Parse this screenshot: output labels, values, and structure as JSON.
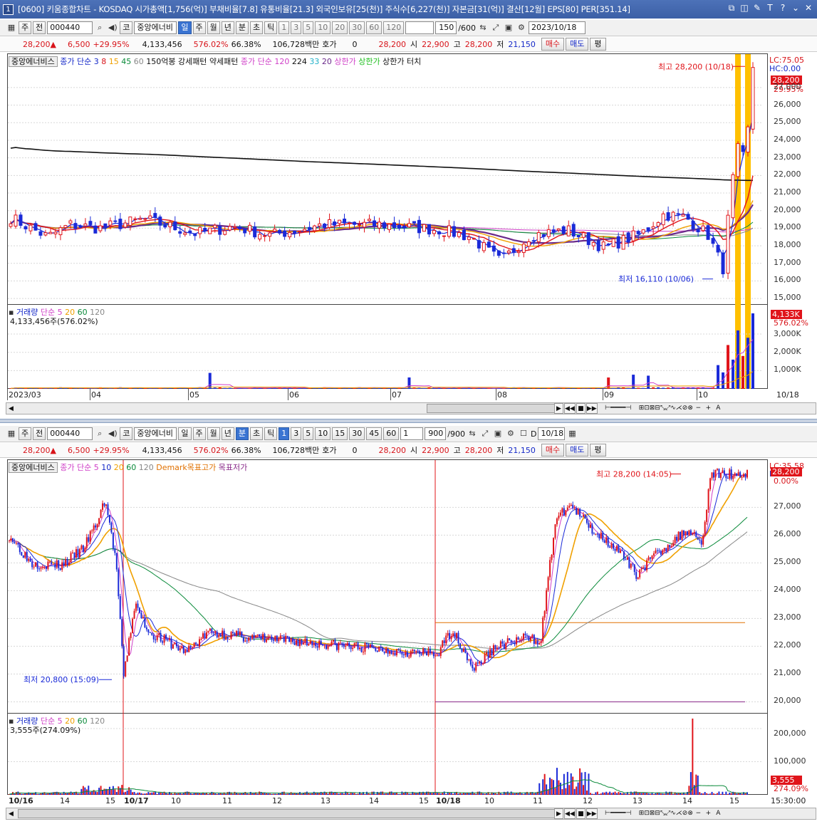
{
  "window": {
    "number": "1",
    "title": "[0600] 키움종합차트 - KOSDAQ 시가총액[1,756(억)] 부채비율[7.8] 유통비율[21.3] 외국인보유[25(천)] 주식수[6,227(천)] 자본금[31(억)] 결산[12월] EPS[80] PER[351.14]",
    "controls": [
      "⧉",
      "◫",
      "✎",
      "T",
      "?",
      "⌄",
      "✕"
    ]
  },
  "top": {
    "toolbar": {
      "mode": "주",
      "prev": "전",
      "code": "000440",
      "market": "코",
      "name": "중앙에너비",
      "periods": [
        "일",
        "주",
        "월",
        "년",
        "분",
        "초",
        "틱"
      ],
      "selected_period": "일",
      "intervals": [
        "1",
        "3",
        "5",
        "10",
        "20",
        "30",
        "60",
        "120"
      ],
      "count": "150",
      "total": "/600",
      "date": "2023/10/18"
    },
    "quote": {
      "price": "28,200",
      "arrow": "▲",
      "change": "6,500",
      "rate": "+29.95%",
      "volume": "4,133,456",
      "vol_rate": "576.02%",
      "ratio": "66.38%",
      "amount": "106,728백만",
      "hoga_label": "호가",
      "hoga": "0",
      "cur": "28,200",
      "open_label": "시",
      "open": "22,900",
      "high_label": "고",
      "high": "28,200",
      "low_label": "저",
      "low": "21,150",
      "buy": "매수",
      "sell": "매도",
      "eval": "평"
    },
    "legend": {
      "name": "중앙에너비스",
      "ma_label": "종가 단순 3",
      "ma": [
        "8",
        "15",
        "45",
        "60"
      ],
      "pattern1": "150억봉 강세패턴",
      "pattern2": "약세패턴",
      "ma2_label": "종가 단순 120",
      "ma2": [
        "224",
        "33",
        "20"
      ],
      "limit_up": "상한가",
      "limit_up2": "상한가",
      "limit_touch": "상한가 터치"
    },
    "lc": "LC:75.05",
    "hc": "HC:0.00",
    "price_box": "28,200",
    "price_pct": "29.95%",
    "y_ticks": [
      "27,000",
      "26,000",
      "25,000",
      "24,000",
      "23,000",
      "22,000",
      "21,000",
      "20,000",
      "19,000",
      "18,000",
      "17,000",
      "16,000",
      "15,000"
    ],
    "high_note": "최고 28,200 (10/18)",
    "low_note": "최저 16,110 (10/06)",
    "vol_legend": {
      "label": "거래량",
      "type": "단순",
      "ma": [
        "5",
        "20",
        "60",
        "120"
      ]
    },
    "vol_value": "4,133,456주(576.02%)",
    "vol_box": "4,133K",
    "vol_pct": "576.02%",
    "vol_ticks": [
      "3,000K",
      "2,000K",
      "1,000K"
    ],
    "x_labels": [
      "2023/03",
      "04",
      "05",
      "06",
      "07",
      "08",
      "09",
      "10",
      "10/18"
    ]
  },
  "bottom": {
    "toolbar": {
      "mode": "주",
      "prev": "전",
      "code": "000440",
      "market": "코",
      "name": "중앙에너비",
      "periods": [
        "일",
        "주",
        "월",
        "년",
        "분",
        "초",
        "틱"
      ],
      "selected_period": "분",
      "intervals": [
        "1",
        "3",
        "5",
        "10",
        "15",
        "30",
        "45",
        "60"
      ],
      "sel_interval": "1",
      "count": "900",
      "total": "/900",
      "date": "10/18",
      "d_label": "D"
    },
    "quote": {
      "price": "28,200",
      "arrow": "▲",
      "change": "6,500",
      "rate": "+29.95%",
      "volume": "4,133,456",
      "vol_rate": "576.02%",
      "ratio": "66.38%",
      "amount": "106,728백만",
      "hoga_label": "호가",
      "hoga": "0",
      "cur": "28,200",
      "open_label": "시",
      "open": "22,900",
      "high_label": "고",
      "high": "28,200",
      "low_label": "저",
      "low": "21,150",
      "buy": "매수",
      "sell": "매도",
      "eval": "평"
    },
    "legend": {
      "name": "중앙에너비스",
      "ma_label": "종가 단순 5",
      "ma": [
        "10",
        "20",
        "60",
        "120"
      ],
      "demark_high": "Demark목표고가",
      "demark_low": "목표저가"
    },
    "lc": "LC:35.58",
    "hc": "HC:0.00",
    "price_box": "28,200",
    "price_pct": "0.00%",
    "y_ticks": [
      "27,000",
      "26,000",
      "25,000",
      "24,000",
      "23,000",
      "22,000",
      "21,000",
      "20,000"
    ],
    "high_note": "최고 28,200 (14:05)",
    "low_note": "최저 20,800 (15:09)",
    "vol_legend": {
      "label": "거래량",
      "type": "단순",
      "ma": [
        "5",
        "20",
        "60",
        "120"
      ]
    },
    "vol_value": "3,555주(274.09%)",
    "vol_box": "3,555",
    "vol_pct": "274.09%",
    "vol_ticks": [
      "200,000",
      "100,000"
    ],
    "x_labels": [
      "10/16",
      "14",
      "15",
      "10/17",
      "10",
      "11",
      "12",
      "13",
      "14",
      "15",
      "10/18",
      "10",
      "11",
      "12",
      "13",
      "14",
      "15",
      "15:30:00"
    ]
  },
  "colors": {
    "up": "#e0141a",
    "down": "#1a2ad8",
    "ma_black": "#111111",
    "ma_magenta": "#d040c8",
    "ma_orange": "#f0a000",
    "ma_green": "#0a8a3a",
    "ma_purple": "#6a2a8a",
    "limit_bar": "#ffc000"
  },
  "chart_data": [
    {
      "type": "candlestick",
      "title": "중앙에너비스 일봉",
      "x_range": [
        "2023/03",
        "2023/10/18"
      ],
      "ylim": [
        15000,
        28200
      ],
      "high": 28200,
      "high_date": "10/18",
      "low": 16110,
      "low_date": "10/06",
      "last_close": 28200
    },
    {
      "type": "candlestick",
      "title": "중앙에너비스 1분봉",
      "x_range": [
        "10/16",
        "10/18 15:30"
      ],
      "ylim": [
        20000,
        28200
      ],
      "high": 28200,
      "high_time": "14:05",
      "low": 20800,
      "low_time": "15:09",
      "demark_high": 22850,
      "demark_low": 20000
    }
  ]
}
